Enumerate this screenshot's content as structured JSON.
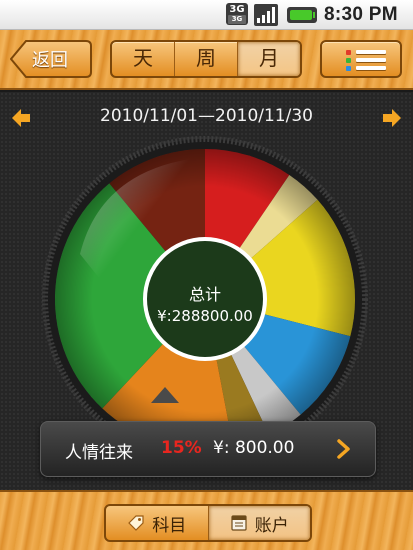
{
  "statusbar": {
    "network": "3G",
    "network_sub": "3G",
    "time": "8:30 PM"
  },
  "header": {
    "back_label": "返回",
    "period_tabs": [
      {
        "label": "天",
        "active": false
      },
      {
        "label": "周",
        "active": false
      },
      {
        "label": "月",
        "active": true
      }
    ],
    "menu_icon": "list-icon"
  },
  "date_range": "2010/11/01—2010/11/30",
  "pie": {
    "center_title": "总计",
    "center_value": "¥:288800.00",
    "slices": [
      {
        "color": "#e01f1f",
        "share": 0.095
      },
      {
        "color": "#f7e79a",
        "share": 0.04
      },
      {
        "color": "#f5e020",
        "share": 0.155
      },
      {
        "color": "#2a9be2",
        "share": 0.1
      },
      {
        "color": "#d2d2d2",
        "share": 0.04
      },
      {
        "color": "#9a7a20",
        "share": 0.04
      },
      {
        "color": "#f08a1c",
        "share": 0.15
      },
      {
        "color": "#2fae3c",
        "share": 0.27
      },
      {
        "color": "#7a2412",
        "share": 0.11
      }
    ],
    "selected_index": 5
  },
  "selected_item": {
    "category": "人情往来",
    "percent": "15%",
    "amount": "¥: 800.00"
  },
  "footer": {
    "tabs": [
      {
        "label": "科目",
        "icon": "tag-icon",
        "active": false
      },
      {
        "label": "账户",
        "icon": "account-book-icon",
        "active": true
      }
    ]
  },
  "colors": {
    "wood": "#e9a13f",
    "highlight_red": "#e8261f",
    "dark_bg": "#262626"
  }
}
